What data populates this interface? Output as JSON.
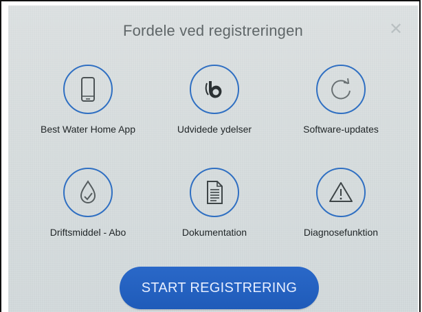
{
  "dialog": {
    "title": "Fordele ved registreringen",
    "close_icon": "close-icon"
  },
  "features": [
    {
      "label": "Best Water Home App",
      "icon": "smartphone-icon"
    },
    {
      "label": "Udvidede ydelser",
      "icon": "bwt-logo-icon"
    },
    {
      "label": "Software-updates",
      "icon": "refresh-icon"
    },
    {
      "label": "Driftsmiddel - Abo",
      "icon": "droplet-check-icon"
    },
    {
      "label": "Dokumentation",
      "icon": "document-icon"
    },
    {
      "label": "Diagnosefunktion",
      "icon": "warning-triangle-icon"
    }
  ],
  "actions": {
    "start_label": "START REGISTRERING"
  },
  "colors": {
    "accent": "#2f6fc2",
    "button": "#1f5bb9",
    "background": "#d6dcdd"
  }
}
